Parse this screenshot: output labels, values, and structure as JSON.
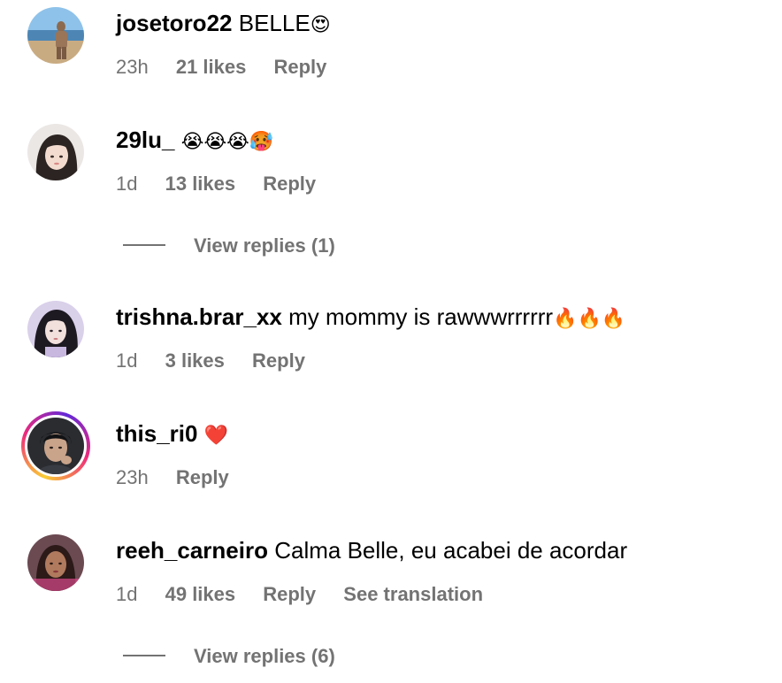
{
  "comments": [
    {
      "username": "josetoro22",
      "text": "BELLE",
      "emoji": "😍",
      "time": "23h",
      "likes": "21 likes",
      "reply": "Reply"
    },
    {
      "username": "29lu_",
      "text": "",
      "emoji": "😭😭😭🥵",
      "time": "1d",
      "likes": "13 likes",
      "reply": "Reply",
      "view_replies": "View replies (1)"
    },
    {
      "username": "trishna.brar_xx",
      "text": "my mommy is rawwwrrrrrr",
      "emoji": "🔥🔥🔥",
      "time": "1d",
      "likes": "3 likes",
      "reply": "Reply"
    },
    {
      "username": "this_ri0",
      "text": "",
      "emoji": "❤️",
      "time": "23h",
      "reply": "Reply"
    },
    {
      "username": "reeh_carneiro",
      "text": "Calma Belle, eu acabei de acordar",
      "emoji": "",
      "time": "1d",
      "likes": "49 likes",
      "reply": "Reply",
      "see_translation": "See translation",
      "view_replies": "View replies (6)"
    }
  ],
  "colors": {
    "meta": "#737373",
    "story_ring": [
      "#f9ce34",
      "#ee2a7b",
      "#6228d7"
    ]
  }
}
